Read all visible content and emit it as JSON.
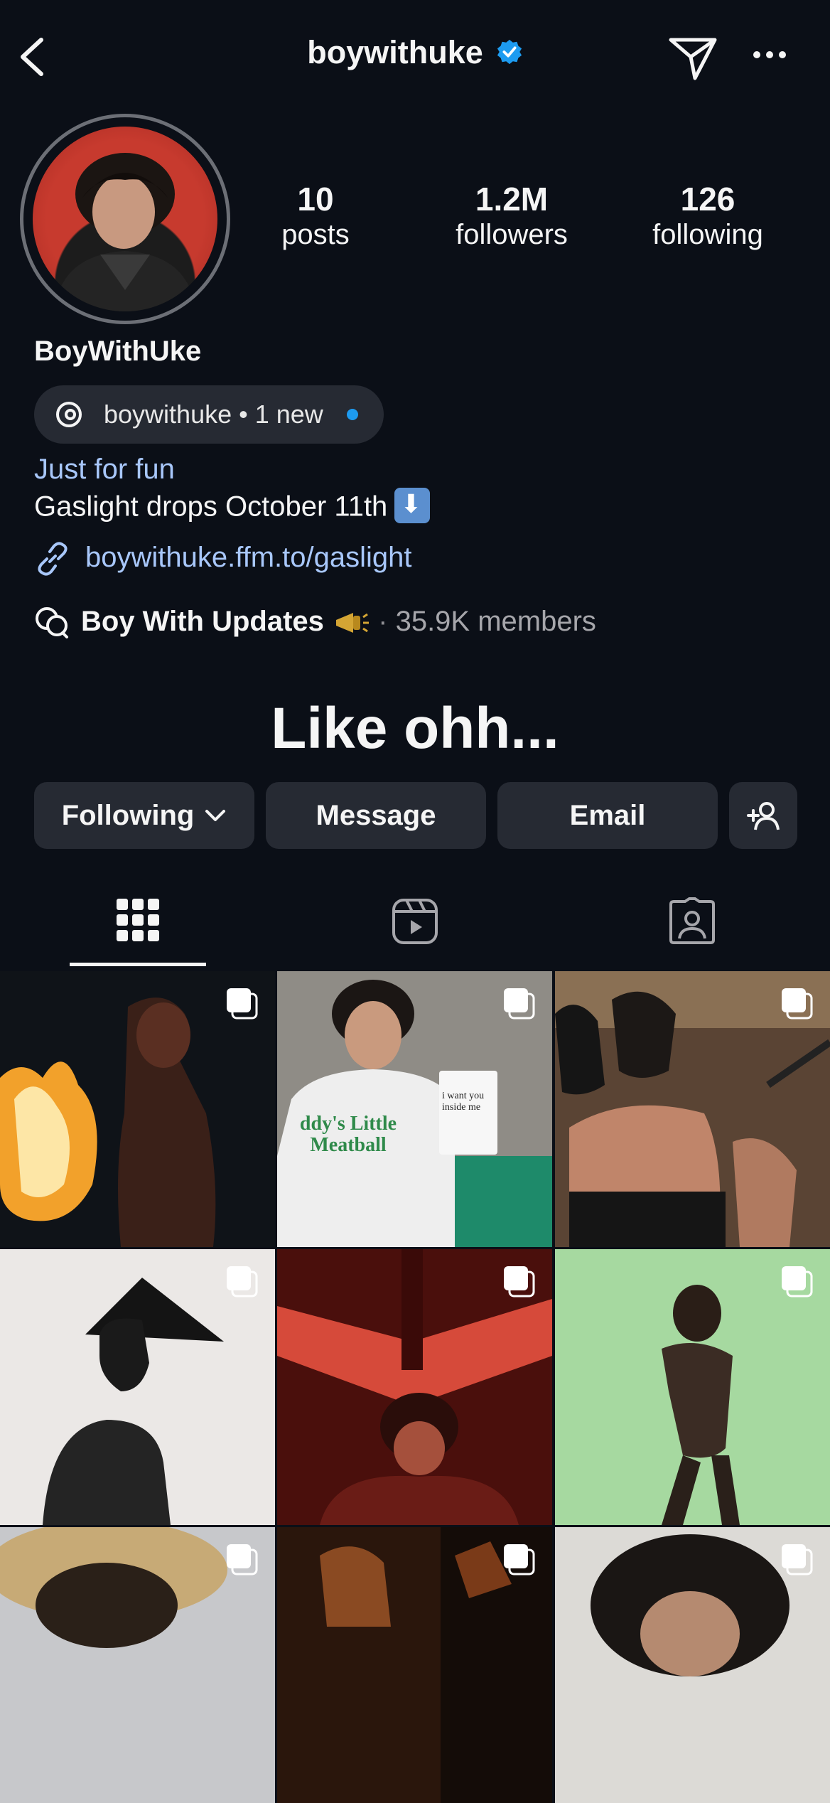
{
  "header": {
    "username": "boywithuke",
    "icons": [
      "back-icon",
      "verified-badge-icon",
      "send-icon",
      "more-icon"
    ]
  },
  "stats": [
    {
      "value": "10",
      "label": "posts"
    },
    {
      "value": "1.2M",
      "label": "followers"
    },
    {
      "value": "126",
      "label": "following"
    }
  ],
  "profile": {
    "display_name": "BoyWithUke",
    "threads_badge": "boywithuke • 1 new",
    "category": "Just for fun",
    "bio": "Gaslight drops October 11th",
    "link": "boywithuke.ffm.to/gaslight",
    "channel_name": "Boy With Updates",
    "channel_sep": "·",
    "channel_members": "35.9K members",
    "song_text": "Like ohh..."
  },
  "buttons": {
    "following": "Following",
    "message": "Message",
    "email": "Email"
  },
  "tabs": [
    "grid-icon",
    "reels-icon",
    "tagged-icon"
  ],
  "posts": [
    {
      "label": ""
    },
    {
      "label": "",
      "shirt_text": "ddy's Little Meatball",
      "sign_text": "i want you inside me"
    },
    {
      "label": ""
    },
    {
      "label": ""
    },
    {
      "label": ""
    },
    {
      "label": ""
    },
    {
      "label": ""
    },
    {
      "label": ""
    },
    {
      "label": ""
    }
  ],
  "colors": {
    "background": "#0b0f17",
    "button": "#262a33",
    "link": "#a8c7fa",
    "verified": "#1d9bf0"
  }
}
